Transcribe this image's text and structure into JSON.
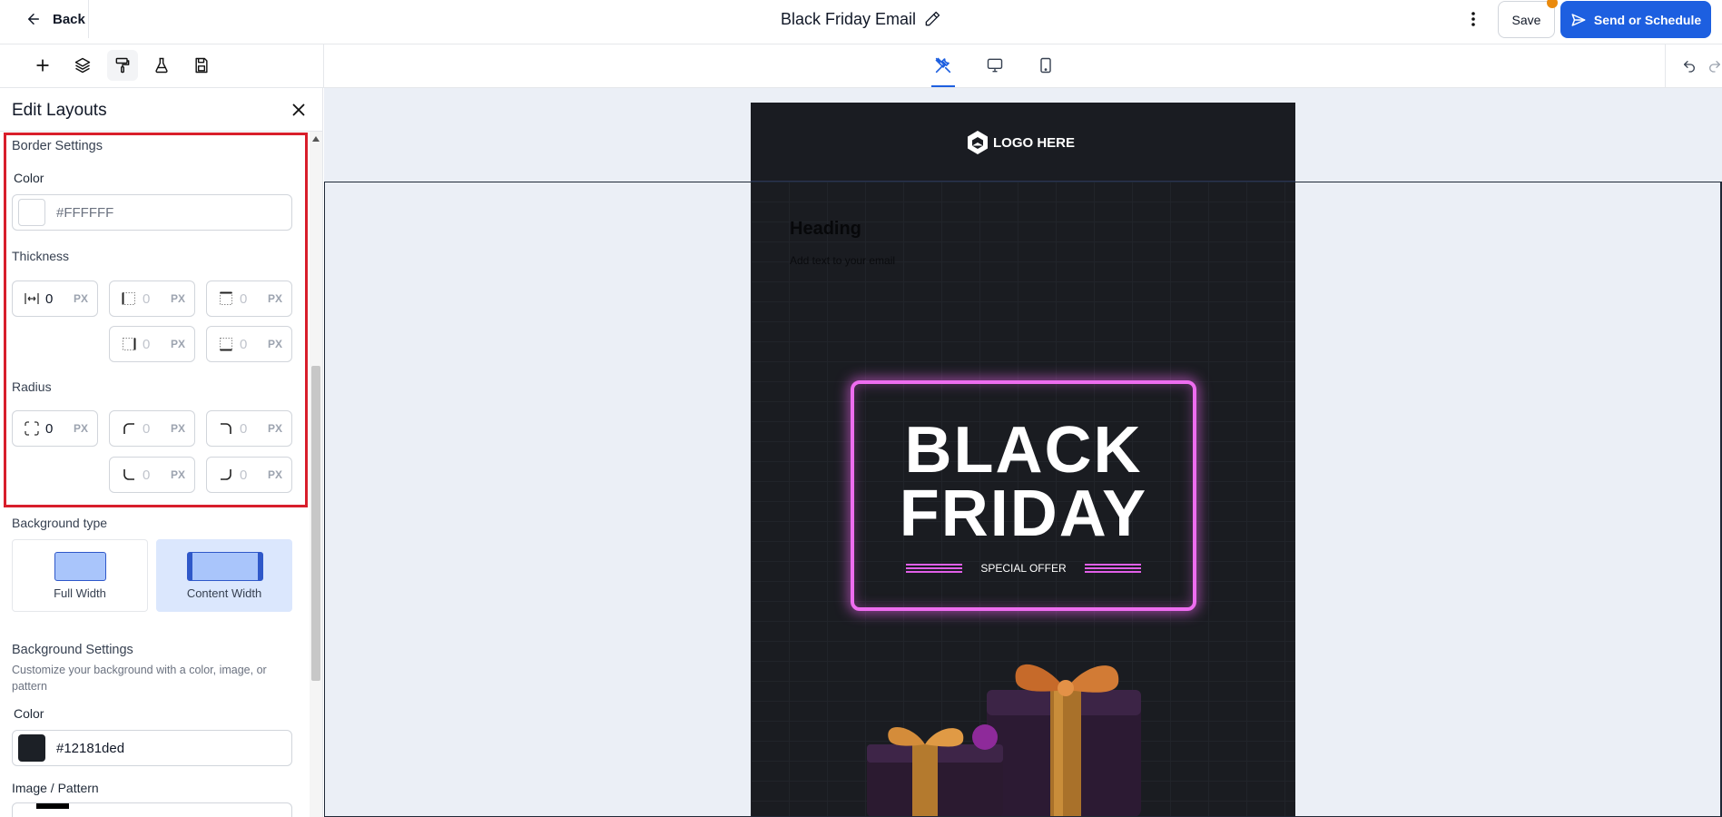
{
  "topbar": {
    "back_label": "Back",
    "title": "Black Friday Email",
    "save_label": "Save",
    "send_label": "Send or Schedule"
  },
  "toolbar": {
    "tools": [
      "add-icon",
      "layers-icon",
      "paint-roller-icon",
      "flask-icon",
      "save-template-icon"
    ],
    "active_tool": "paint-roller-icon",
    "devices": [
      "design-tools-icon",
      "desktop-icon",
      "mobile-icon"
    ],
    "active_device": "design-tools-icon"
  },
  "panel": {
    "title": "Edit Layouts",
    "border_settings": {
      "heading": "Border Settings",
      "color_label": "Color",
      "color_value": "#FFFFFF",
      "thickness_label": "Thickness",
      "thickness": {
        "all": "0",
        "left": "0",
        "top": "0",
        "right": "0",
        "bottom": "0",
        "unit": "PX"
      },
      "radius_label": "Radius",
      "radius": {
        "all": "0",
        "top_left": "0",
        "top_right": "0",
        "bottom_left": "0",
        "bottom_right": "0",
        "unit": "PX"
      }
    },
    "background_type": {
      "heading": "Background type",
      "options": [
        "Full Width",
        "Content Width"
      ],
      "selected": "Content Width"
    },
    "background_settings": {
      "heading": "Background Settings",
      "description": "Customize your background with a color, image, or pattern",
      "color_label": "Color",
      "color_value": "#12181ded",
      "swatch_color": "#1c2026",
      "image_label": "Image / Pattern"
    }
  },
  "email": {
    "logo_text": "LOGO HERE",
    "heading": "Heading",
    "body_text": "Add text to your email",
    "banner_line1": "BLACK",
    "banner_line2": "FRIDAY",
    "banner_offer": "SPECIAL OFFER"
  },
  "colors": {
    "accent": "#1d5fe0",
    "highlight": "#d81e2b",
    "neon": "#ee6df0",
    "email_bg": "#1c1e24",
    "canvas_bg": "#ebeff6"
  }
}
